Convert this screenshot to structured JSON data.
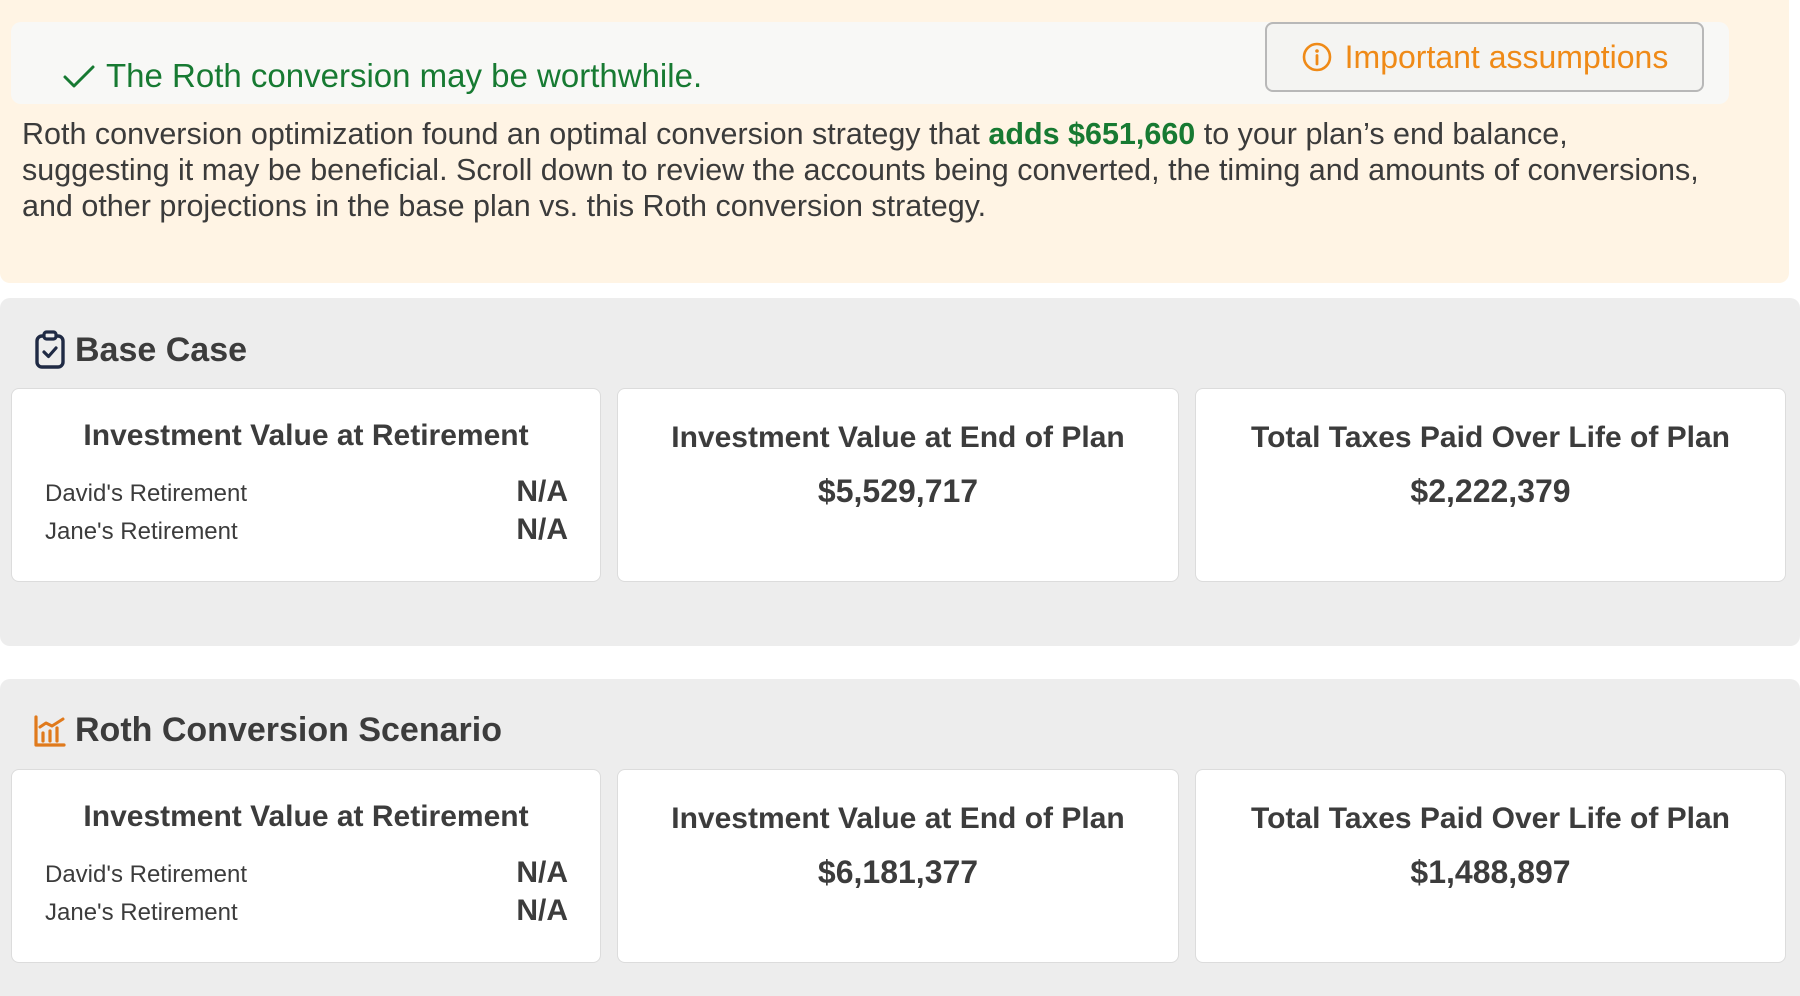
{
  "result": {
    "title": "The Roth conversion may be worthwhile.",
    "assumptions_label": "Important assumptions",
    "description_before": "Roth conversion optimization found an optimal conversion strategy that ",
    "description_highlight": "adds $651,660",
    "description_after": " to your plan’s end balance, suggesting it may be beneficial. Scroll down to review the accounts being converted, the timing and amounts of conversions, and other projections in the base plan vs. this Roth conversion strategy.",
    "colors": {
      "success": "#177a32",
      "accent": "#ef8a17",
      "banner_background": "#fff4e4"
    }
  },
  "base_case": {
    "title": "Base Case",
    "icon": "clipboard-check-icon",
    "retirement": {
      "title": "Investment Value at Retirement",
      "rows": [
        {
          "label": "David's Retirement",
          "value": "N/A"
        },
        {
          "label": "Jane's Retirement",
          "value": "N/A"
        }
      ]
    },
    "end_of_plan": {
      "title": "Investment Value at End of Plan",
      "value": "$5,529,717"
    },
    "taxes": {
      "title": "Total Taxes Paid Over Life of Plan",
      "value": "$2,222,379"
    }
  },
  "roth_scenario": {
    "title": "Roth Conversion Scenario",
    "icon": "chart-growth-icon",
    "retirement": {
      "title": "Investment Value at Retirement",
      "rows": [
        {
          "label": "David's Retirement",
          "value": "N/A"
        },
        {
          "label": "Jane's Retirement",
          "value": "N/A"
        }
      ]
    },
    "end_of_plan": {
      "title": "Investment Value at End of Plan",
      "value": "$6,181,377"
    },
    "taxes": {
      "title": "Total Taxes Paid Over Life of Plan",
      "value": "$1,488,897"
    }
  }
}
